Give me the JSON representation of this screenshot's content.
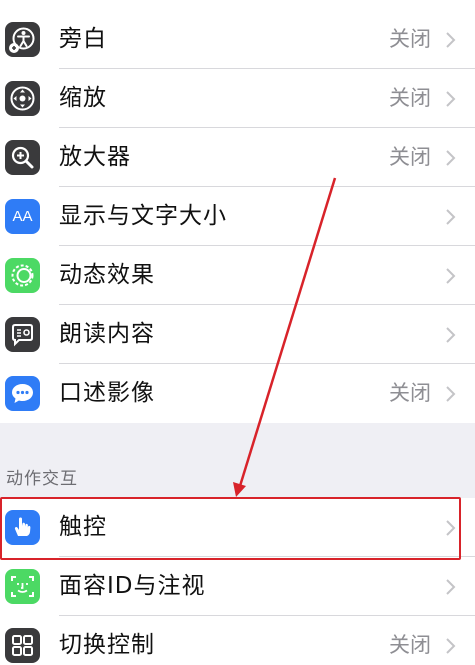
{
  "settings": {
    "items": [
      {
        "label": "旁白",
        "value": "关闭",
        "icon": "voiceover-icon",
        "color": "#3a3a3c"
      },
      {
        "label": "缩放",
        "value": "关闭",
        "icon": "zoom-icon",
        "color": "#3a3a3c"
      },
      {
        "label": "放大器",
        "value": "关闭",
        "icon": "magnifier-icon",
        "color": "#3a3a3c"
      },
      {
        "label": "显示与文字大小",
        "value": "",
        "icon": "display-text-size-icon",
        "color": "#2f7cf6"
      },
      {
        "label": "动态效果",
        "value": "",
        "icon": "motion-icon",
        "color": "#4cd964"
      },
      {
        "label": "朗读内容",
        "value": "",
        "icon": "spoken-content-icon",
        "color": "#3a3a3c"
      },
      {
        "label": "口述影像",
        "value": "关闭",
        "icon": "audio-descriptions-icon",
        "color": "#2f7cf6"
      }
    ],
    "section_header": "动作交互",
    "interaction_items": [
      {
        "label": "触控",
        "value": "",
        "icon": "touch-icon",
        "color": "#2f7cf6"
      },
      {
        "label": "面容ID与注视",
        "value": "",
        "icon": "face-id-icon",
        "color": "#4cd964"
      },
      {
        "label": "切换控制",
        "value": "关闭",
        "icon": "switch-control-icon",
        "color": "#3a3a3c"
      }
    ],
    "icon_glyphs": {
      "display_text_size": "AA",
      "spoken_content": "☰"
    }
  },
  "colors": {
    "highlight": "#d8232a",
    "secondary_text": "#8e8e93",
    "background": "#efeff4"
  }
}
